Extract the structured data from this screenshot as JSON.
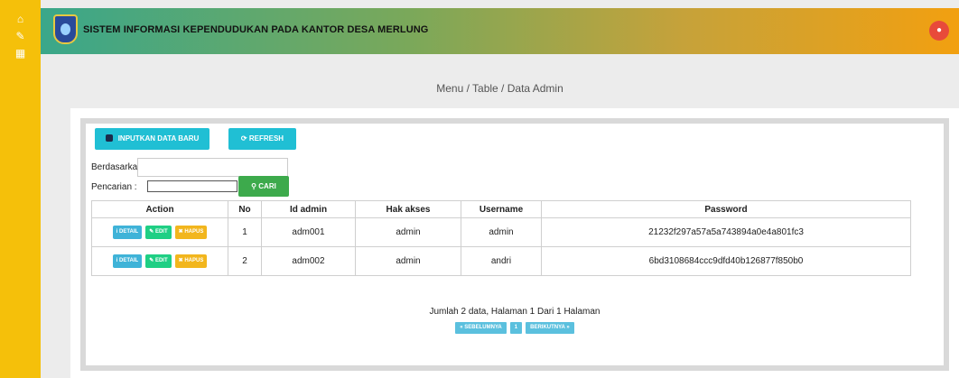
{
  "sidebar": {
    "icons": [
      "home-icon",
      "edit-icon",
      "calendar-icon"
    ]
  },
  "header": {
    "title": "SISTEM INFORMASI KEPENDUDUKAN PADA KANTOR DESA MERLUNG",
    "brand_color": "#3aa78a",
    "accent_color": "#f2a010"
  },
  "breadcrumb": "Menu / Table / Data Admin",
  "toolbar": {
    "new_label": "INPUTKAN DATA BARU",
    "refresh_label": "REFRESH"
  },
  "search": {
    "berdasarkan_label": "Berdasarkan:",
    "berdasarkan_value": "",
    "pencarian_label": "Pencarian",
    "pencarian_value": "",
    "cari_label": "CARI"
  },
  "table": {
    "headers": [
      "Action",
      "No",
      "Id admin",
      "Hak akses",
      "Username",
      "Password"
    ],
    "action_labels": {
      "detail": "DETAIL",
      "edit": "EDIT",
      "hapus": "HAPUS"
    },
    "rows": [
      {
        "no": "1",
        "id": "adm001",
        "hak": "admin",
        "username": "admin",
        "password": "21232f297a57a5a743894a0e4a801fc3"
      },
      {
        "no": "2",
        "id": "adm002",
        "hak": "admin",
        "username": "andri",
        "password": "6bd3108684ccc9dfd40b126877f850b0"
      }
    ]
  },
  "pagination": {
    "summary": "Jumlah 2 data, Halaman 1 Dari 1 Halaman",
    "prev_label": "« SEBELUMNYA",
    "page_label": "1",
    "next_label": "BERIKUTNYA »"
  }
}
